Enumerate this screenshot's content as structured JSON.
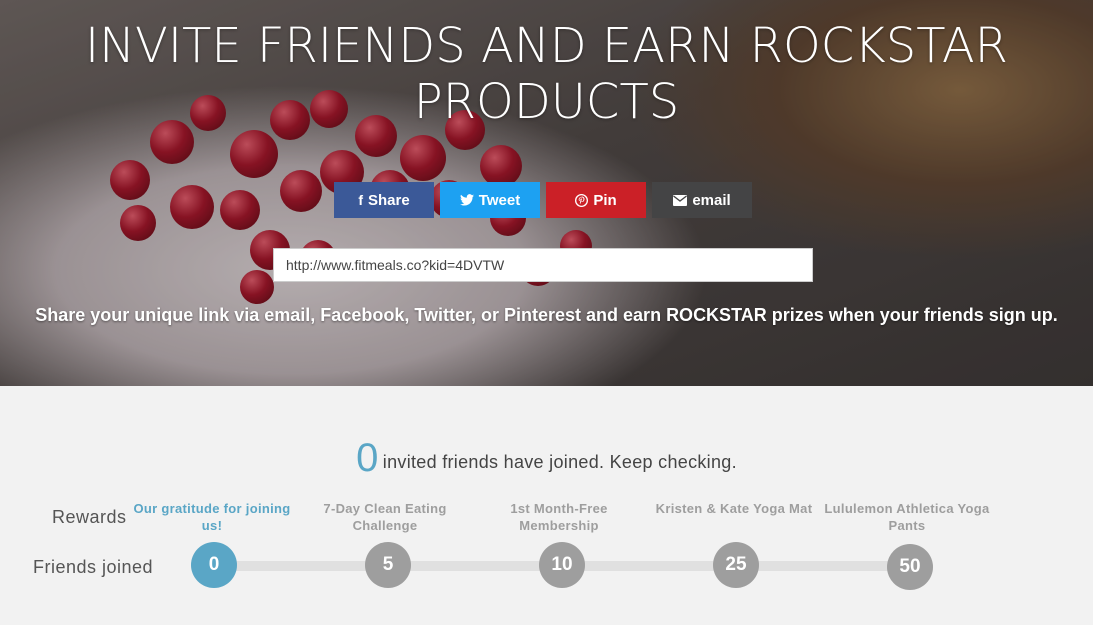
{
  "hero": {
    "title": "INVITE FRIENDS AND EARN ROCKSTAR PRODUCTS",
    "share_buttons": [
      {
        "label": "Share",
        "icon": "facebook-icon",
        "color": "#3b5998"
      },
      {
        "label": "Tweet",
        "icon": "twitter-icon",
        "color": "#1da1f2"
      },
      {
        "label": "Pin",
        "icon": "pinterest-icon",
        "color": "#cb2027"
      },
      {
        "label": "email",
        "icon": "envelope-icon",
        "color": "#444445"
      }
    ],
    "referral_link": "http://www.fitmeals.co?kid=4DVTW",
    "description": "Share your unique link via email, Facebook, Twitter, or Pinterest and earn ROCKSTAR prizes when your friends sign up."
  },
  "progress": {
    "joined_count": "0",
    "joined_text": "invited friends have joined. Keep checking.",
    "rewards_label": "Rewards",
    "friends_label": "Friends joined",
    "accent_color": "#5aa6c6",
    "milestones": [
      {
        "reward": "Our gratitude for joining us!",
        "friends": "0",
        "active": true
      },
      {
        "reward": "7-Day Clean Eating Challenge",
        "friends": "5",
        "active": false
      },
      {
        "reward": "1st Month-Free Membership",
        "friends": "10",
        "active": false
      },
      {
        "reward": "Kristen & Kate Yoga Mat",
        "friends": "25",
        "active": false
      },
      {
        "reward": "Lululemon Athletica Yoga Pants",
        "friends": "50",
        "active": false
      }
    ]
  }
}
